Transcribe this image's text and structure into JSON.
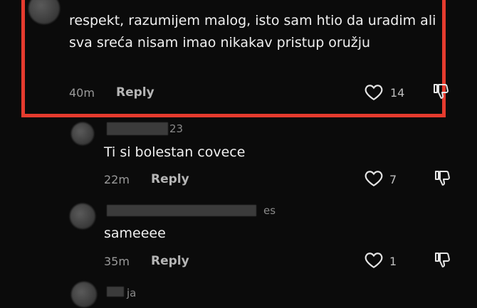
{
  "comments": [
    {
      "text": "respekt, razumijem malog, isto sam htio da uradim ali sva sreća nisam imao nikakav pristup oružju",
      "time": "40m",
      "reply": "Reply",
      "likes": "14"
    },
    {
      "username": "23",
      "text": "Ti si bolestan covece",
      "time": "22m",
      "reply": "Reply",
      "likes": "7"
    },
    {
      "username": "es",
      "text": "sameeee",
      "time": "35m",
      "reply": "Reply",
      "likes": "1"
    },
    {
      "username": "ja"
    }
  ],
  "icons": {
    "like": "heart-outline-icon",
    "dislike": "thumbs-down-icon"
  },
  "colors": {
    "background": "#0b0b0b",
    "highlight_border": "#e63b2e",
    "text": "#f0f0f0",
    "muted": "#9a9a9a"
  }
}
